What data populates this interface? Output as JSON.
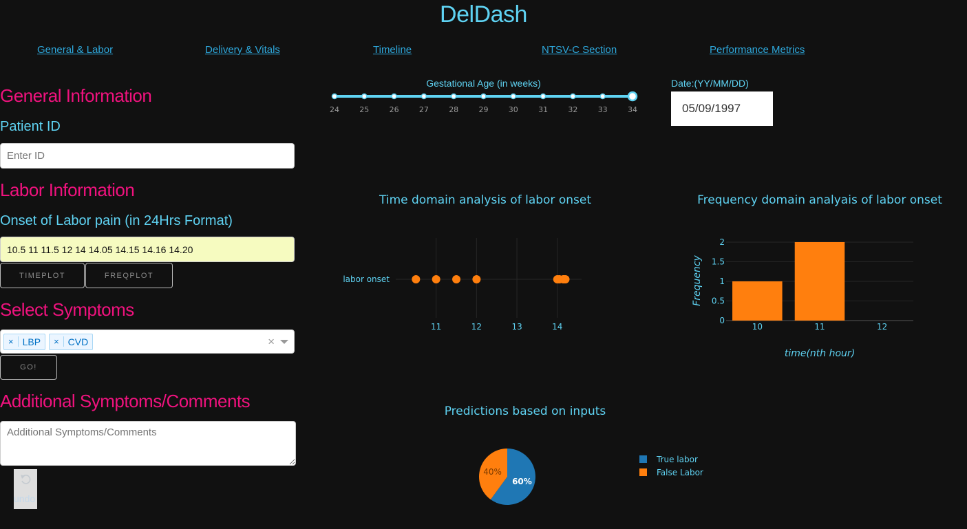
{
  "app": {
    "title": "DelDash"
  },
  "nav": [
    {
      "label": "General & Labor"
    },
    {
      "label": "Delivery & Vitals"
    },
    {
      "label": "Timeline"
    },
    {
      "label": "NTSV-C Section"
    },
    {
      "label": "Performance Metrics"
    }
  ],
  "general": {
    "heading": "General Information",
    "patient_id_label": "Patient ID",
    "patient_id_placeholder": "Enter ID",
    "patient_id_value": ""
  },
  "labor": {
    "heading": "Labor Information",
    "onset_label": "Onset of Labor pain (in 24Hrs Format)",
    "onset_value": "10.5 11 11.5 12 14 14.05 14.15 14.16 14.20",
    "timeplot_button": "TIMEPLOT",
    "freqplot_button": "FREQPLOT"
  },
  "symptoms": {
    "heading": "Select Symptoms",
    "selected": [
      "LBP",
      "CVD"
    ],
    "clear_glyph": "×",
    "go_button": "GO!"
  },
  "additional": {
    "heading": "Additional Symptoms/Comments",
    "placeholder": "Additional Symptoms/Comments"
  },
  "undo": {
    "label": "undo"
  },
  "gestational": {
    "label": "Gestational Age (in weeks)",
    "min": 24,
    "max": 34,
    "value": 34,
    "marks": [
      "24",
      "25",
      "26",
      "27",
      "28",
      "29",
      "30",
      "31",
      "32",
      "33",
      "34"
    ]
  },
  "date": {
    "label": "Date:(YY/MM/DD)",
    "value": "05/09/1997"
  },
  "colors": {
    "accent_cyan": "#5fd3f3",
    "heading_pink": "#f0127e",
    "link_blue": "#2ea8dc",
    "series_orange": "#ff7f0e",
    "series_blue": "#1f77b4"
  },
  "chart_data": [
    {
      "type": "scatter",
      "title": "Time domain analysis of labor onset",
      "y_category": "labor onset",
      "x": [
        10.5,
        11,
        11.5,
        12,
        14,
        14.05,
        14.15,
        14.16,
        14.2
      ],
      "xticks": [
        11,
        12,
        13,
        14
      ],
      "xlim": [
        10.0,
        14.6
      ],
      "grid": true
    },
    {
      "type": "bar",
      "title": "Frequency domain analyais of labor onset",
      "xlabel": "time(nth hour)",
      "ylabel": "Frequency",
      "categories": [
        "10",
        "11",
        "12"
      ],
      "values": [
        1,
        2,
        0
      ],
      "yticks": [
        "0",
        "0.5",
        "1",
        "1.5",
        "2"
      ],
      "ylim": [
        0,
        2
      ]
    },
    {
      "type": "pie",
      "title": "Predictions based on inputs",
      "labels": [
        "True labor",
        "False Labor"
      ],
      "values": [
        60,
        40
      ],
      "slice_labels": [
        "60%",
        "40%"
      ],
      "legend": "right"
    }
  ]
}
